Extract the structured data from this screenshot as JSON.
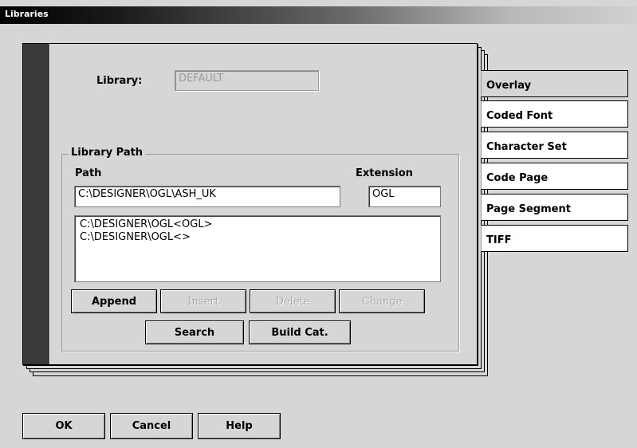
{
  "window": {
    "title": "Libraries"
  },
  "library": {
    "label": "Library:",
    "value": "DEFAULT"
  },
  "library_path": {
    "group_title": "Library Path",
    "path_label": "Path",
    "extension_label": "Extension",
    "path_value": "C:\\DESIGNER\\OGL\\ASH_UK",
    "extension_value": "OGL",
    "list_items": [
      "C:\\DESIGNER\\OGL<OGL>",
      "C:\\DESIGNER\\OGL<>"
    ]
  },
  "buttons": {
    "append": "Append",
    "insert": "Insert",
    "delete": "Delete",
    "change": "Change",
    "search": "Search",
    "build_cat": "Build Cat."
  },
  "tabs": [
    {
      "label": "Overlay"
    },
    {
      "label": "Coded Font"
    },
    {
      "label": "Character Set"
    },
    {
      "label": "Code Page"
    },
    {
      "label": "Page Segment"
    },
    {
      "label": "TIFF"
    }
  ],
  "dialog_buttons": {
    "ok": "OK",
    "cancel": "Cancel",
    "help": "Help"
  }
}
